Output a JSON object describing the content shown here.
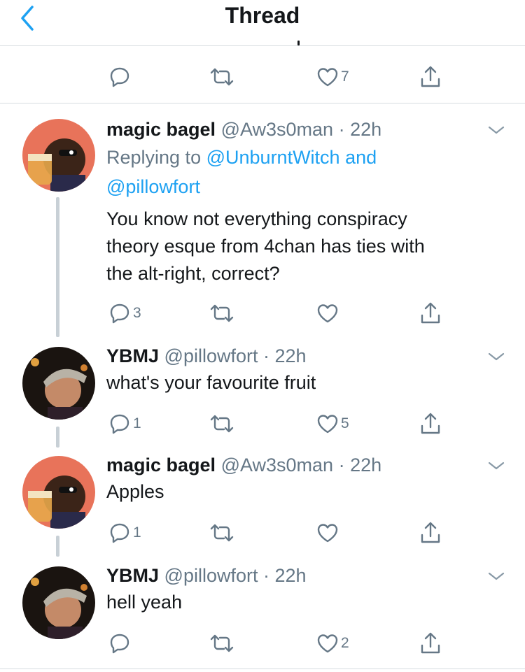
{
  "header": {
    "title": "Thread",
    "back_icon": "chevron-left-icon"
  },
  "top_actions": {
    "like_count": "7"
  },
  "tweets": [
    {
      "name": "magic bagel",
      "handle": "@Aw3s0man",
      "dot": "·",
      "time": "22h",
      "replying_prefix": "Replying to",
      "replying_to_1": "@UnburntWitch",
      "replying_and": "and",
      "replying_to_2": "@pillowfort",
      "text_lines": [
        "You know not everything conspiracy",
        "theory esque from 4chan has ties with",
        "the alt-right, correct?"
      ],
      "reply_count": "3",
      "like_count": ""
    },
    {
      "name": "YBMJ",
      "handle": "@pillowfort",
      "dot": "·",
      "time": "22h",
      "text_lines": [
        "what's your favourite fruit"
      ],
      "reply_count": "1",
      "like_count": "5"
    },
    {
      "name": "magic bagel",
      "handle": "@Aw3s0man",
      "dot": "·",
      "time": "22h",
      "text_lines": [
        "Apples"
      ],
      "reply_count": "1",
      "like_count": ""
    },
    {
      "name": "YBMJ",
      "handle": "@pillowfort",
      "dot": "·",
      "time": "22h",
      "text_lines": [
        "hell yeah"
      ],
      "reply_count": "",
      "like_count": "2"
    }
  ],
  "colors": {
    "accent": "#1da1f2",
    "secondary_text": "#657786",
    "divider": "#d7dce0",
    "thread_line": "#c8d0d6"
  },
  "icons": [
    "reply-icon",
    "retweet-icon",
    "like-icon",
    "share-icon",
    "chevron-down-icon"
  ]
}
